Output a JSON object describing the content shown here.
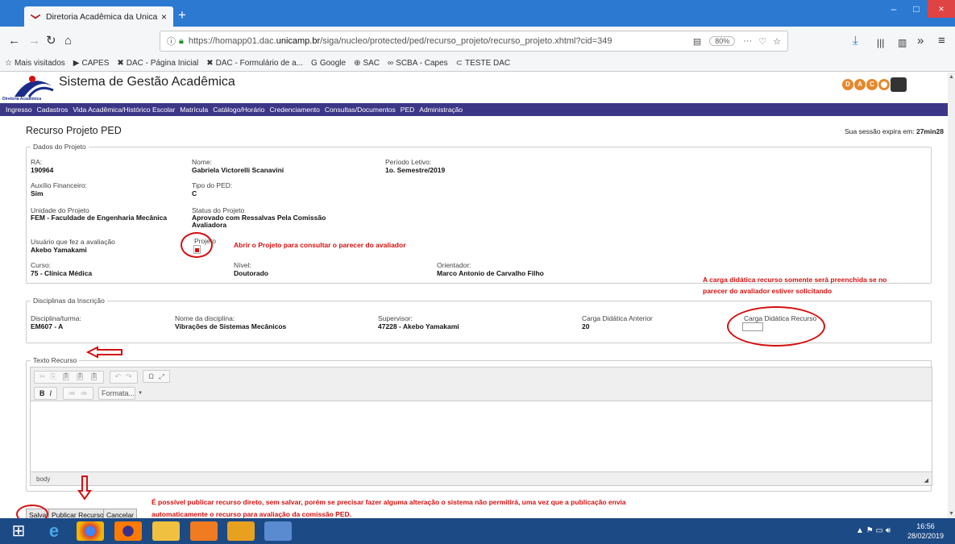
{
  "browser": {
    "tab_title": "Diretoria Acadêmica da Unicam",
    "tab_close": "×",
    "new_tab": "+",
    "win_minimize": "–",
    "win_maximize": "□",
    "win_close": "×",
    "url_info": "ⓘ",
    "url_prefix": "https://homapp01.dac.",
    "url_domain": "unicamp.br",
    "url_path": "/siga/nucleo/protected/ped/recurso_projeto/recurso_projeto.xhtml?cid=349",
    "zoom": "80%",
    "menu_dots": "···",
    "bookmarks": [
      {
        "icon": "☆",
        "label": "Mais visitados"
      },
      {
        "icon": "▶",
        "label": "CAPES"
      },
      {
        "icon": "✖",
        "label": "DAC - Página Inicial"
      },
      {
        "icon": "✖",
        "label": "DAC - Formulário de a..."
      },
      {
        "icon": "G",
        "label": "Google"
      },
      {
        "icon": "⊕",
        "label": "SAC"
      },
      {
        "icon": "∞",
        "label": "SCBA - Capes"
      },
      {
        "icon": "⊂",
        "label": "TESTE DAC"
      }
    ]
  },
  "header": {
    "system_name": "Sistema de Gestão Acadêmica",
    "logo_text": "Diretoria Acadêmica",
    "uni_letters": [
      "D",
      "A",
      "C"
    ]
  },
  "menu": [
    "Ingresso",
    "Cadastros",
    "Vida Acadêmica/Histórico Escolar",
    "Matrícula",
    "Catálogo/Horário",
    "Credenciamento",
    "Consultas/Documentos",
    "PED",
    "Administração"
  ],
  "page": {
    "title": "Recurso Projeto PED",
    "session_label": "Sua sessão expira em:",
    "session_time": "27min28"
  },
  "project": {
    "legend": "Dados do Projeto",
    "ra_label": "RA:",
    "ra": "190964",
    "nome_label": "Nome:",
    "nome": "Gabriela Victorelli Scanavini",
    "periodo_label": "Período Letivo:",
    "periodo": "1o. Semestre/2019",
    "auxilio_label": "Auxílio Financeiro:",
    "auxilio": "Sim",
    "tipo_label": "Tipo do PED:",
    "tipo": "C",
    "unidade_label": "Unidade do Projeto",
    "unidade": "FEM - Faculdade de Engenharia Mecânica",
    "status_label": "Status do Projeto",
    "status_1": "Aprovado com Ressalvas Pela Comissão",
    "status_2": "Avaliadora",
    "usuario_label": "Usuário que fez a avaliação",
    "usuario": "Akebo Yamakami",
    "projeto_label": "Projeto",
    "curso_label": "Curso:",
    "curso": "75 - Clínica Médica",
    "nivel_label": "Nível:",
    "nivel": "Doutorado",
    "orientador_label": "Orientador:",
    "orientador": "Marco Antonio de Carvalho Filho"
  },
  "annotations": {
    "projeto_note": "Abrir o Projeto para consultar o parecer do avaliador",
    "carga_note_1": "A carga didática recurso somente será preenchida se no",
    "carga_note_2": "parecer do avaliador estiver solicitando",
    "publish_note_1": "É possível publicar recurso direto, sem salvar, porém se precisar fazer alguma alteração o sistema não permitirá, uma vez que a publicação envia",
    "publish_note_2": "automaticamente o recurso para avaliação da comissão PED."
  },
  "disciplines": {
    "legend": "Disciplinas da Inscrição",
    "disc_label": "Disciplina/turma:",
    "disc": "EM607 - A",
    "nome_label": "Nome da disciplina:",
    "nome": "Vibrações de Sistemas Mecânicos",
    "supervisor_label": "Supervisor:",
    "supervisor": "47228 - Akebo Yamakami",
    "carga_ant_label": "Carga Didática Anterior",
    "carga_ant": "20",
    "carga_rec_label": "Carga Didática Recurso"
  },
  "texto": {
    "legend": "Texto Recurso",
    "format_label": "Formata...",
    "footer": "body"
  },
  "buttons": {
    "salvar": "Salvar",
    "publicar": "Publicar Recurso",
    "cancelar": "Cancelar"
  },
  "taskbar": {
    "time": "16:56",
    "date": "28/02/2019"
  },
  "colors": {
    "menu_bg": "#3b3686",
    "annotation_red": "#d41010",
    "tabbar": "#2b79d1"
  }
}
